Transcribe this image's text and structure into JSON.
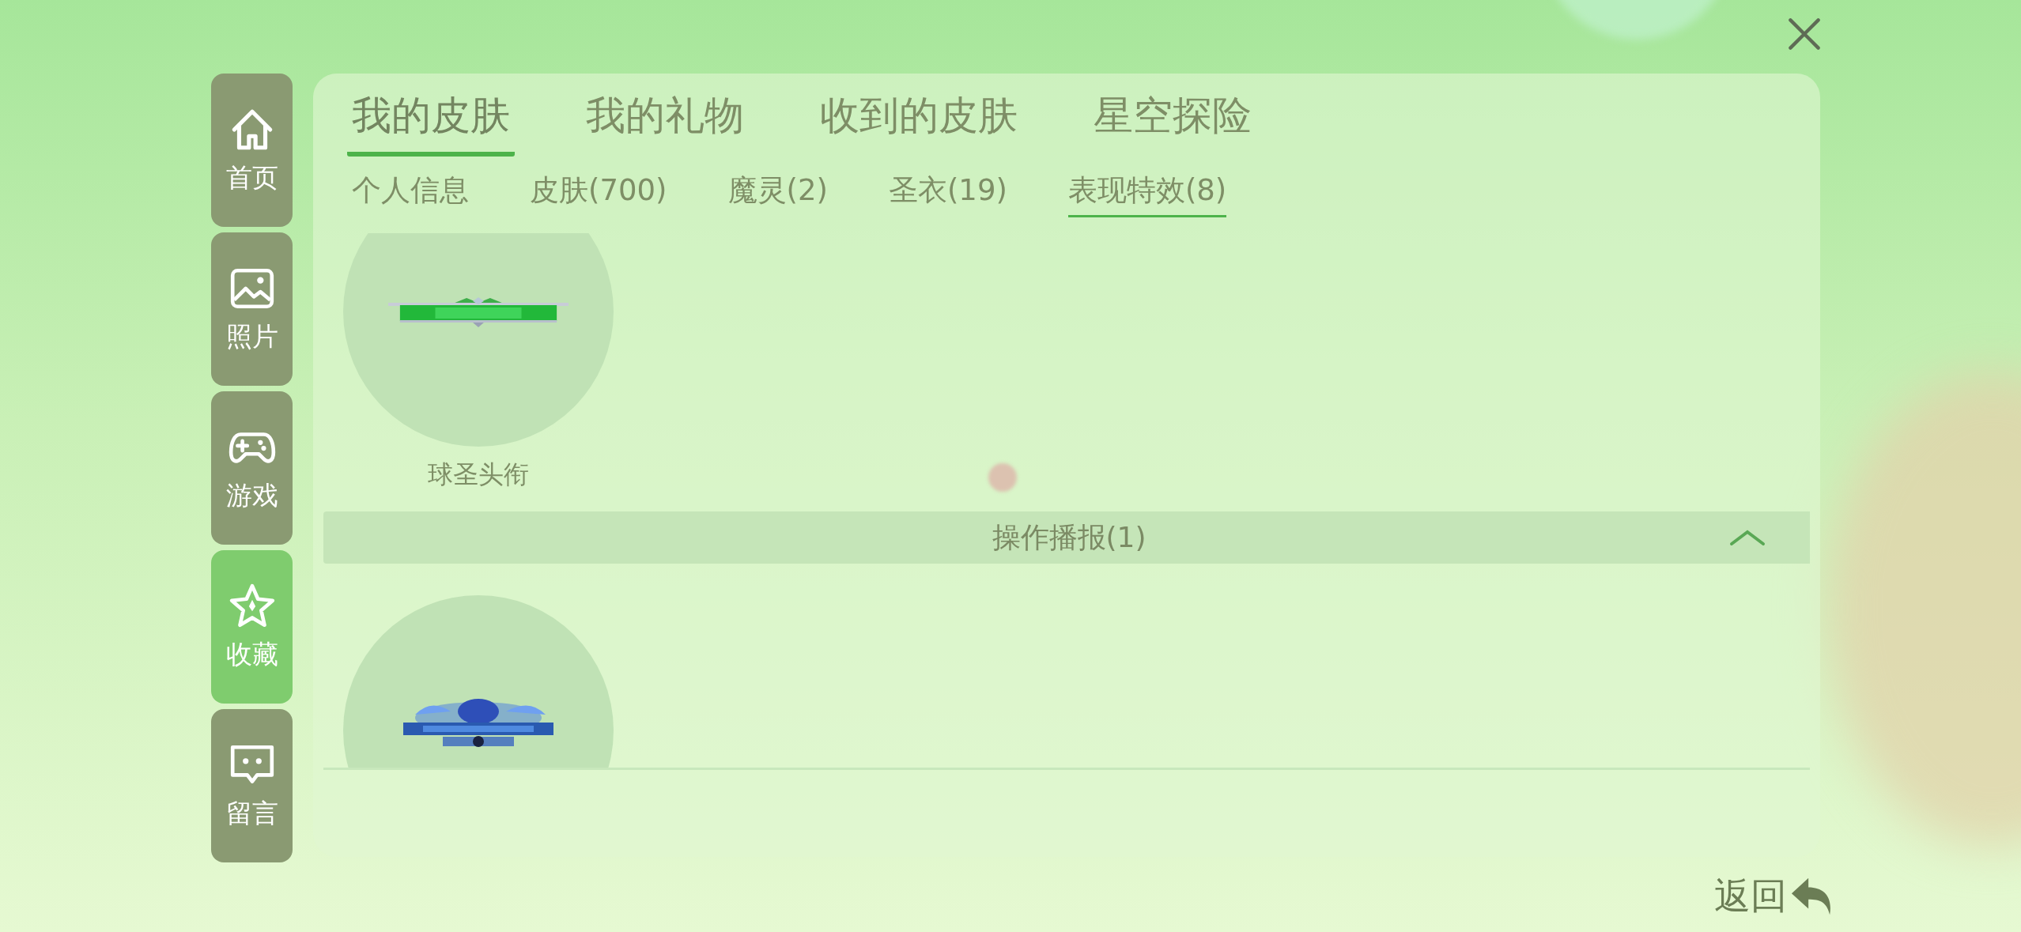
{
  "sidebar": {
    "items": [
      {
        "label": "首页",
        "kind": "home",
        "selected": false
      },
      {
        "label": "照片",
        "selected": false
      },
      {
        "label": "游戏",
        "kind": "game",
        "selected": false
      },
      {
        "label": "收藏",
        "kind": "star",
        "selected": true
      },
      {
        "label": "留言",
        "kind": "message",
        "selected": false
      }
    ]
  },
  "tabs": [
    {
      "label": "我的皮肤",
      "selected": true
    },
    {
      "label": "我的礼物",
      "selected": false
    },
    {
      "label": "收到的皮肤",
      "selected": false
    },
    {
      "label": "星空探险",
      "selected": false
    }
  ],
  "subtabs": [
    {
      "label": "个人信息",
      "selected": false
    },
    {
      "label": "皮肤(700)",
      "selected": false
    },
    {
      "label": "魔灵(2)",
      "selected": false
    },
    {
      "label": "圣衣(19)",
      "selected": false
    },
    {
      "label": "表现特效(8)",
      "selected": true
    }
  ],
  "items": [
    {
      "label": "球圣头衔",
      "kind": "picture"
    }
  ],
  "section": {
    "title": "操作播报(1)",
    "expanded": true
  },
  "back_button": {
    "label": "返回"
  }
}
